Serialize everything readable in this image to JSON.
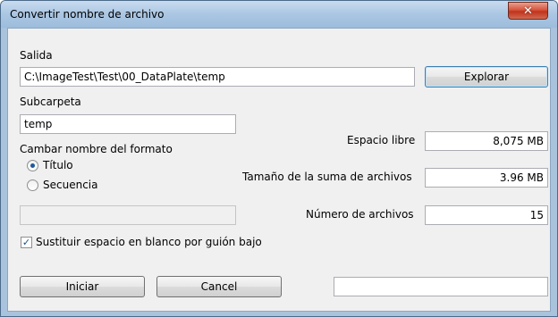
{
  "window": {
    "title": "Convertir nombre de archivo",
    "close_glyph": "✕"
  },
  "output": {
    "label": "Salida",
    "path": "C:\\ImageTest\\Test\\00_DataPlate\\temp",
    "browse_label": "Explorar"
  },
  "subfolder": {
    "label": "Subcarpeta",
    "value": "temp"
  },
  "rename": {
    "label": "Cambar nombre del formato",
    "options": [
      {
        "label": "Título",
        "selected": true
      },
      {
        "label": "Secuencia",
        "selected": false
      }
    ],
    "sequence_value": ""
  },
  "stats": {
    "free_space_label": "Espacio libre",
    "free_space_value": "8,075 MB",
    "total_size_label": "Tamaño de la suma de archivos",
    "total_size_value": "3.96 MB",
    "file_count_label": "Número de archivos",
    "file_count_value": "15"
  },
  "replace_spaces": {
    "label": "Sustituir espacio en blanco por guión bajo",
    "checked": true,
    "check_glyph": "✓"
  },
  "actions": {
    "start_label": "Iniciar",
    "cancel_label": "Cancel",
    "status_text": ""
  }
}
